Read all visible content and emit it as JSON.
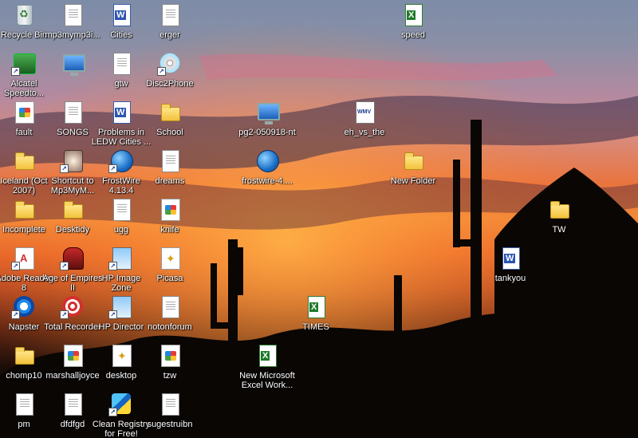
{
  "desktop": {
    "icons": [
      {
        "label": "Recycle Bin",
        "glyph": "recycle-bin-icon"
      },
      {
        "label": "mp3mymp3i...",
        "glyph": "media-player-doc-icon"
      },
      {
        "label": "Cities",
        "glyph": "word-document-icon"
      },
      {
        "label": "erger",
        "glyph": "text-document-icon"
      },
      {
        "label": "speed",
        "glyph": "excel-spreadsheet-icon"
      },
      {
        "label": "Alcatel Speedto...",
        "glyph": "network-modem-icon"
      },
      {
        "label": "",
        "glyph": "my-computer-icon"
      },
      {
        "label": "gtw",
        "glyph": "text-document-icon"
      },
      {
        "label": "Disc2Phone",
        "glyph": "disc2phone-app-icon"
      },
      {
        "label": "fault",
        "glyph": "image-file-icon"
      },
      {
        "label": "SONGS",
        "glyph": "text-document-icon"
      },
      {
        "label": "Problems in LEDW Cities ...",
        "glyph": "word-document-icon"
      },
      {
        "label": "School",
        "glyph": "folder-icon"
      },
      {
        "label": "pg2-050918-nt",
        "glyph": "installer-icon"
      },
      {
        "label": "eh_vs_the",
        "glyph": "wmv-video-icon"
      },
      {
        "label": "Iceland (Oct 2007)",
        "glyph": "folder-icon"
      },
      {
        "label": "Shortcut to Mp3MyM...",
        "glyph": "shortcut-app-icon"
      },
      {
        "label": "FrostWire 4.13.4",
        "glyph": "frostwire-icon"
      },
      {
        "label": "dreams",
        "glyph": "text-document-icon"
      },
      {
        "label": "frostwire-4....",
        "glyph": "frostwire-icon"
      },
      {
        "label": "New Folder",
        "glyph": "folder-icon"
      },
      {
        "label": "Incomplete",
        "glyph": "folder-icon"
      },
      {
        "label": "Desktidy",
        "glyph": "folder-icon"
      },
      {
        "label": "ugg",
        "glyph": "text-document-icon"
      },
      {
        "label": "knife",
        "glyph": "image-file-icon"
      },
      {
        "label": "TW",
        "glyph": "folder-icon"
      },
      {
        "label": "Adobe Reader 8",
        "glyph": "adobe-reader-icon"
      },
      {
        "label": "Age of Empires II",
        "glyph": "age-of-empires-icon"
      },
      {
        "label": "HP Image Zone",
        "glyph": "hp-image-zone-icon"
      },
      {
        "label": "Picasa",
        "glyph": "picasa-icon"
      },
      {
        "label": "tankyou",
        "glyph": "word-document-icon"
      },
      {
        "label": "Napster",
        "glyph": "napster-icon"
      },
      {
        "label": "Total Recorder",
        "glyph": "total-recorder-icon"
      },
      {
        "label": "HP Director",
        "glyph": "hp-director-icon"
      },
      {
        "label": "notonforum",
        "glyph": "text-document-icon"
      },
      {
        "label": "TIMES",
        "glyph": "excel-spreadsheet-icon"
      },
      {
        "label": "chomp10",
        "glyph": "zip-folder-icon"
      },
      {
        "label": "marshalljoyce",
        "glyph": "image-file-icon"
      },
      {
        "label": "desktop",
        "glyph": "picasa-doc-icon"
      },
      {
        "label": "tzw",
        "glyph": "image-file-icon"
      },
      {
        "label": "New Microsoft Excel Work...",
        "glyph": "excel-spreadsheet-icon"
      },
      {
        "label": "pm",
        "glyph": "text-document-icon"
      },
      {
        "label": "dfdfgd",
        "glyph": "text-document-icon"
      },
      {
        "label": "Clean Registry for Free!",
        "glyph": "clean-registry-icon"
      },
      {
        "label": "sugestruibn",
        "glyph": "text-document-icon"
      }
    ]
  }
}
